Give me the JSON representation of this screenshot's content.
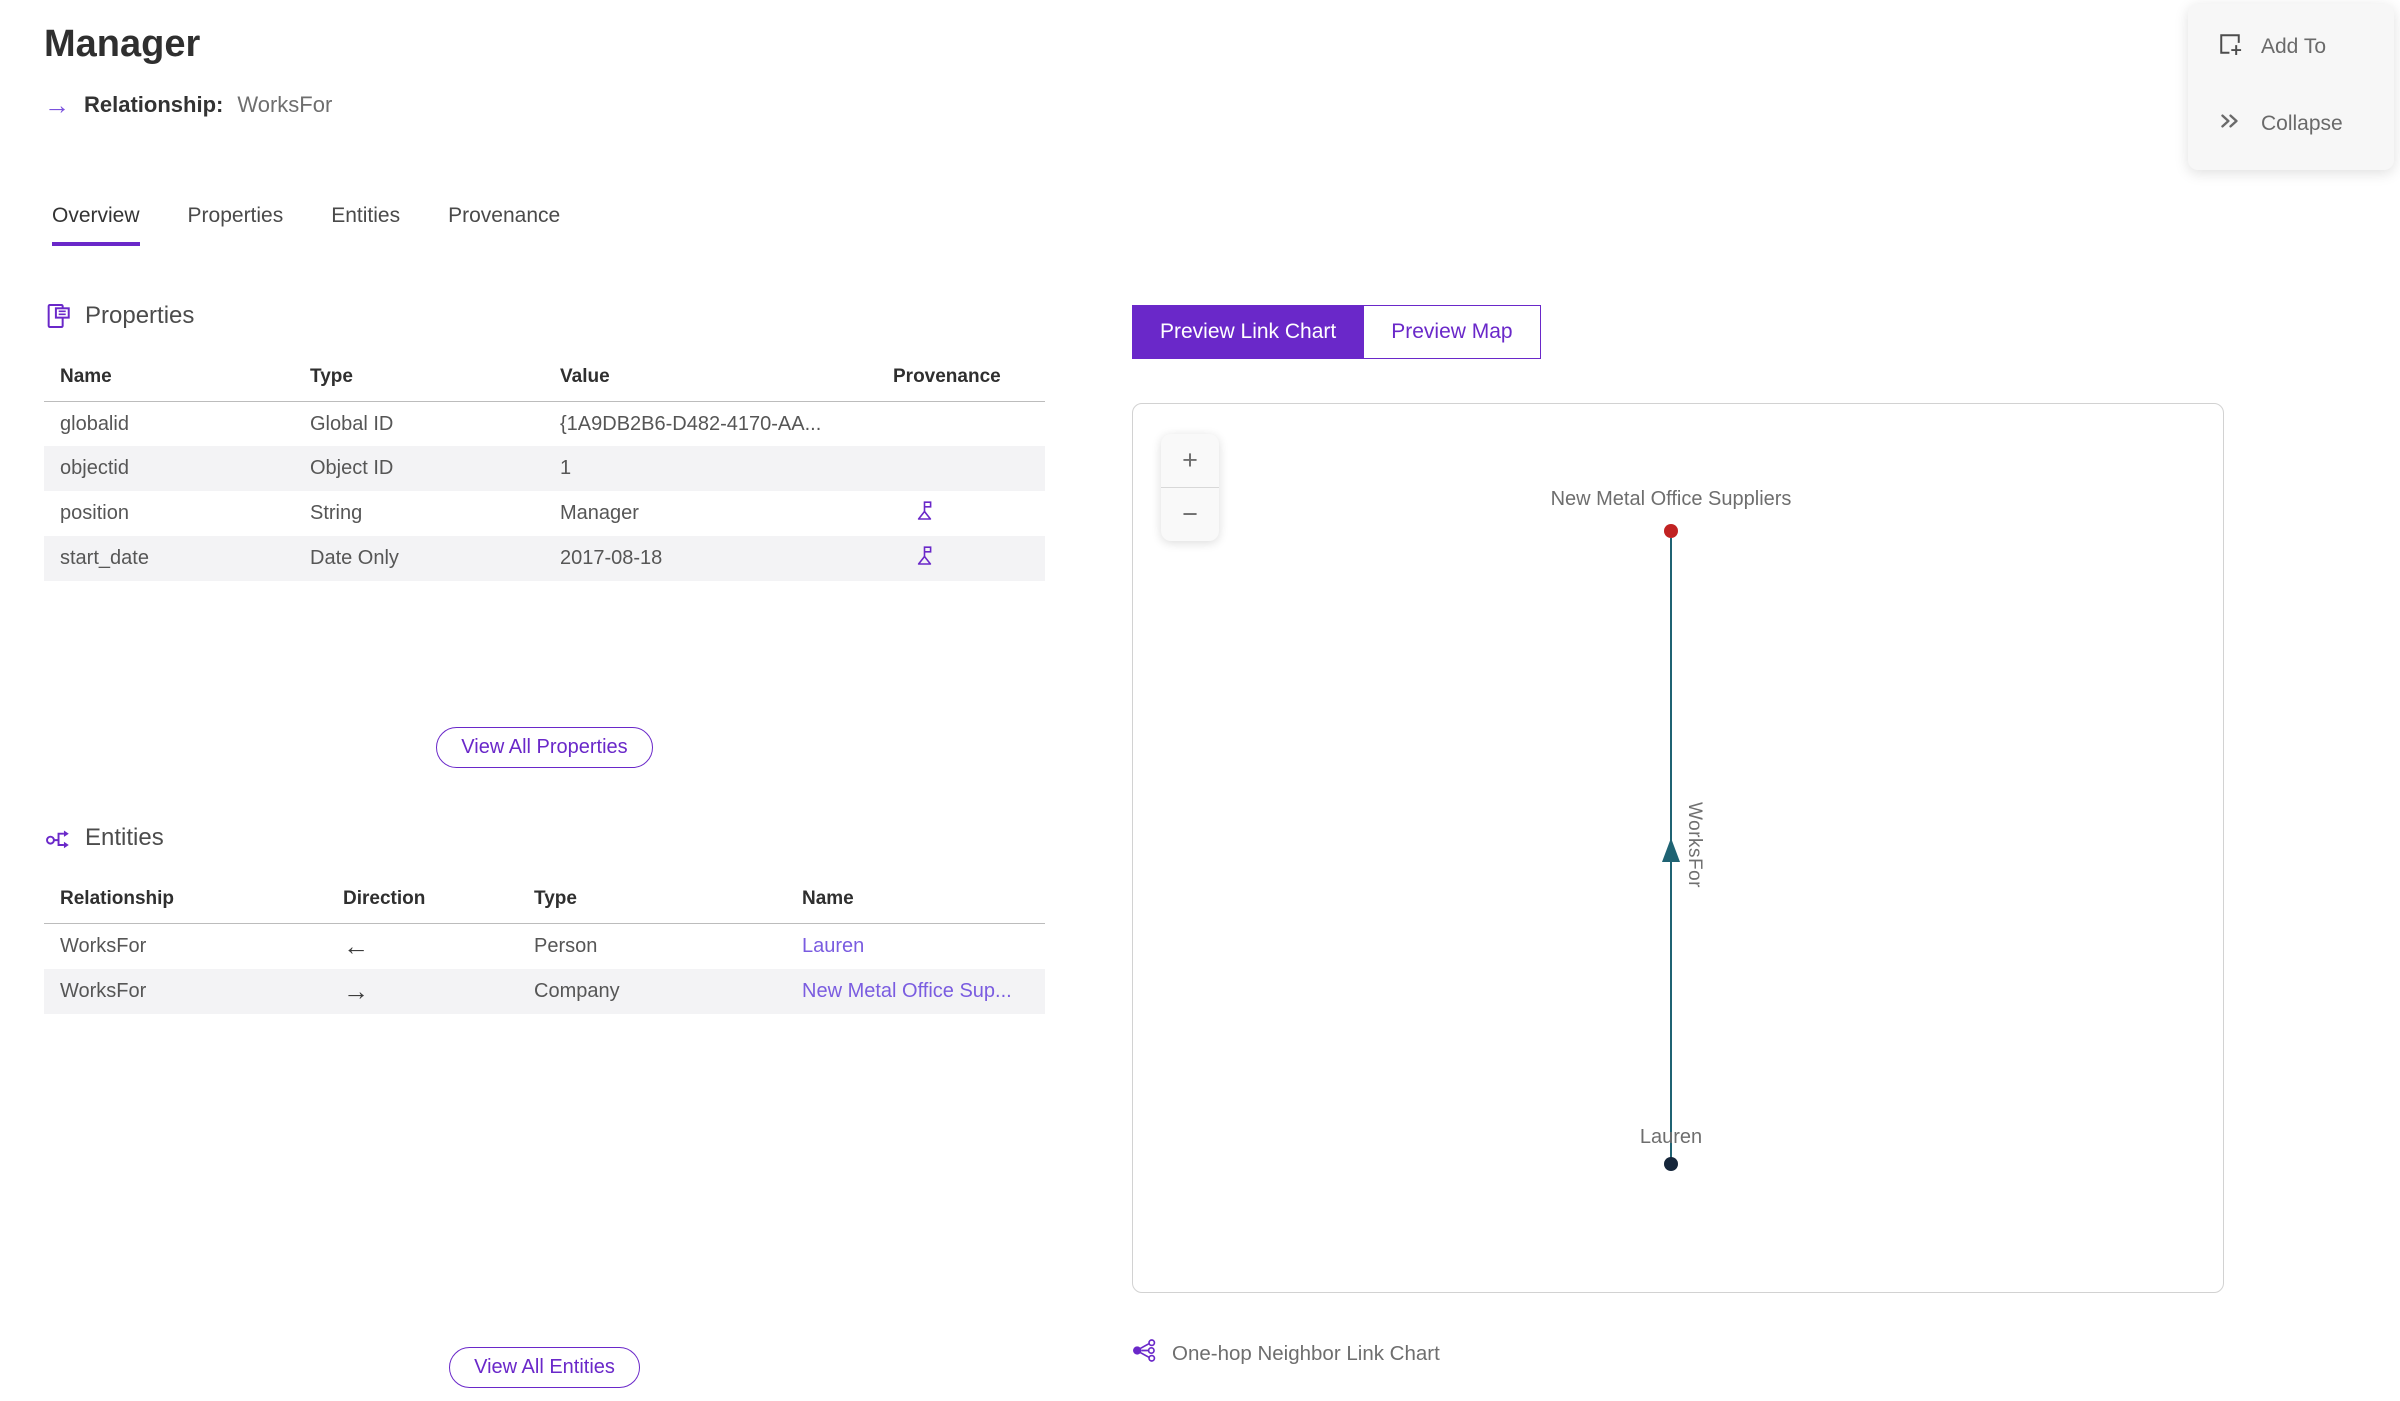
{
  "header": {
    "title": "Manager",
    "subtitle_label": "Relationship:",
    "subtitle_value": "WorksFor",
    "subtitle_arrow": "→"
  },
  "float_actions": {
    "add_to": "Add To",
    "collapse": "Collapse"
  },
  "tabs": [
    {
      "label": "Overview",
      "active": true
    },
    {
      "label": "Properties",
      "active": false
    },
    {
      "label": "Entities",
      "active": false
    },
    {
      "label": "Provenance",
      "active": false
    }
  ],
  "properties_section": {
    "title": "Properties",
    "columns": [
      "Name",
      "Type",
      "Value",
      "Provenance"
    ],
    "rows": [
      {
        "name": "globalid",
        "type": "Global ID",
        "value": "{1A9DB2B6-D482-4170-AA...",
        "has_provenance": false
      },
      {
        "name": "objectid",
        "type": "Object ID",
        "value": "1",
        "has_provenance": false
      },
      {
        "name": "position",
        "type": "String",
        "value": "Manager",
        "has_provenance": true
      },
      {
        "name": "start_date",
        "type": "Date Only",
        "value": "2017-08-18",
        "has_provenance": true
      }
    ],
    "view_all_label": "View All Properties"
  },
  "entities_section": {
    "title": "Entities",
    "columns": [
      "Relationship",
      "Direction",
      "Type",
      "Name"
    ],
    "rows": [
      {
        "relationship": "WorksFor",
        "direction": "incoming",
        "direction_glyph": "←",
        "type": "Person",
        "name": "Lauren"
      },
      {
        "relationship": "WorksFor",
        "direction": "outgoing",
        "direction_glyph": "→",
        "type": "Company",
        "name": "New Metal Office Sup..."
      }
    ],
    "view_all_label": "View All Entities"
  },
  "preview": {
    "link_chart_label": "Preview Link Chart",
    "map_label": "Preview Map",
    "selected": "Preview Link Chart",
    "zoom_in": "+",
    "zoom_out": "−",
    "caption": "One-hop Neighbor Link Chart",
    "chart": {
      "top_node": {
        "label": "New Metal Office Suppliers",
        "color": "#c12222"
      },
      "bottom_node": {
        "label": "Lauren",
        "color": "#15263a"
      },
      "edge": {
        "label": "WorksFor",
        "color": "#1f6373",
        "arrow_direction": "up"
      }
    }
  },
  "colors": {
    "accent_purple": "#6a28c9",
    "link_purple": "#7a5ce0",
    "edge_teal": "#1f6373",
    "company_node_red": "#c12222",
    "person_node_dark": "#15263a",
    "row_alt_bg": "#f3f3f5"
  }
}
